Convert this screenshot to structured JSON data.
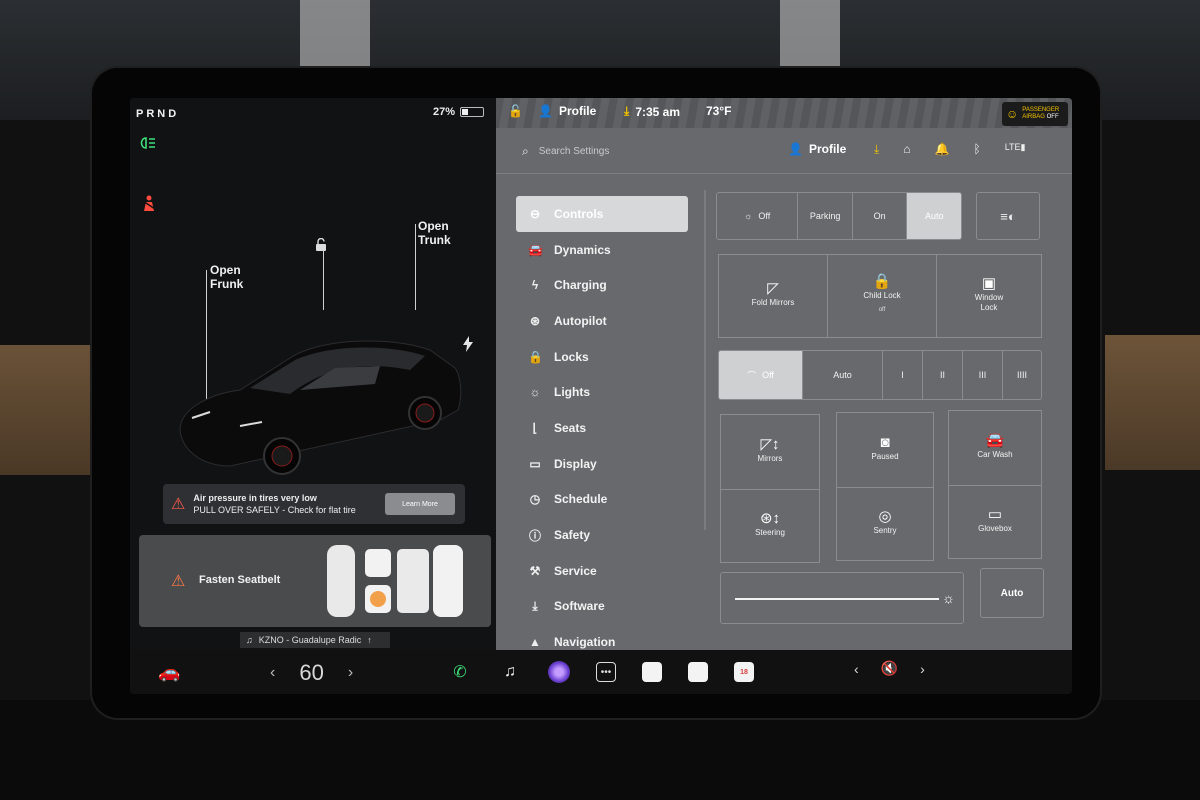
{
  "status": {
    "gears": "PRND",
    "battery_percent": "27%",
    "battery_level": 0.27
  },
  "car": {
    "frunk_label": "Open\nFrunk",
    "trunk_label": "Open\nTrunk"
  },
  "alerts": {
    "tire_title": "Air pressure in tires very low",
    "tire_body": "PULL OVER SAFELY - Check for flat tire",
    "learn_more": "Learn More",
    "seatbelt": "Fasten Seatbelt"
  },
  "media": {
    "now_playing": "KZNO - Guadalupe Radic"
  },
  "topbar": {
    "profile": "Profile",
    "time": "7:35 am",
    "temp": "73°F",
    "airbag_line1": "PASSENGER",
    "airbag_line2": "AIRBAG",
    "airbag_state": "OFF"
  },
  "settings": {
    "search_placeholder": "Search Settings",
    "profile": "Profile"
  },
  "menu": [
    {
      "label": "Controls",
      "icon": "toggle-icon",
      "active": true
    },
    {
      "label": "Dynamics",
      "icon": "car-icon"
    },
    {
      "label": "Charging",
      "icon": "bolt-icon"
    },
    {
      "label": "Autopilot",
      "icon": "steering-wheel-icon"
    },
    {
      "label": "Locks",
      "icon": "lock-icon"
    },
    {
      "label": "Lights",
      "icon": "bulb-icon"
    },
    {
      "label": "Seats",
      "icon": "seat-icon"
    },
    {
      "label": "Display",
      "icon": "display-icon"
    },
    {
      "label": "Schedule",
      "icon": "clock-icon"
    },
    {
      "label": "Safety",
      "icon": "info-icon"
    },
    {
      "label": "Service",
      "icon": "wrench-icon"
    },
    {
      "label": "Software",
      "icon": "download-icon"
    },
    {
      "label": "Navigation",
      "icon": "nav-icon"
    }
  ],
  "controls": {
    "lights": [
      "Off",
      "Parking",
      "On",
      "Auto"
    ],
    "lights_selected": "Auto",
    "fold_mirrors": "Fold Mirrors",
    "child_lock": "Child Lock",
    "child_lock_state": "off",
    "window_lock_1": "Window",
    "window_lock_2": "Lock",
    "wipers": [
      "Off",
      "Auto",
      "I",
      "II",
      "III",
      "IIII"
    ],
    "wipers_selected": "Off",
    "mirrors": "Mirrors",
    "paused": "Paused",
    "car_wash": "Car Wash",
    "steering": "Steering",
    "sentry": "Sentry",
    "glovebox": "Glovebox",
    "brightness_auto": "Auto"
  },
  "dock": {
    "temperature": "60",
    "calendar_day": "18"
  },
  "colors": {
    "accent_green": "#3ee07a",
    "warning_red": "#ff4b3e",
    "panel_gray": "#67696c"
  }
}
